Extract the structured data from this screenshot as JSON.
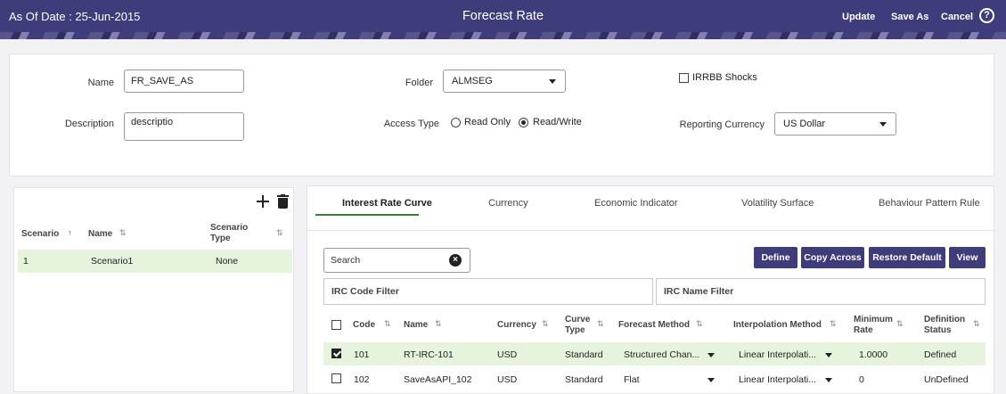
{
  "header": {
    "as_of_date": "As Of Date : 25-Jun-2015",
    "title": "Forecast Rate",
    "update_label": "Update",
    "save_as_label": "Save As",
    "cancel_label": "Cancel",
    "help_label": "?"
  },
  "form": {
    "name_label": "Name",
    "name_value": "FR_SAVE_AS",
    "description_label": "Description",
    "description_value": "descriptio",
    "folder_label": "Folder",
    "folder_value": "ALMSEG",
    "access_type_label": "Access Type",
    "access_options": [
      "Read Only",
      "Read/Write"
    ],
    "access_selected": "Read/Write",
    "irrbb_label": "IRRBB Shocks",
    "irrbb_checked": false,
    "reporting_currency_label": "Reporting Currency",
    "reporting_currency_value": "US Dollar"
  },
  "scenario_panel": {
    "columns": [
      "Scenario",
      "Name",
      "Scenario Type"
    ],
    "rows": [
      {
        "scenario": "1",
        "name": "Scenario1",
        "type": "None"
      }
    ]
  },
  "tabs": [
    "Interest Rate Curve",
    "Currency",
    "Economic Indicator",
    "Volatility Surface",
    "Behaviour Pattern Rule"
  ],
  "active_tab": "Interest Rate Curve",
  "toolbar": {
    "search_placeholder": "Search",
    "define_label": "Define",
    "copy_across_label": "Copy Across",
    "restore_default_label": "Restore Default",
    "view_label": "View"
  },
  "filters": {
    "irc_code": "IRC Code Filter",
    "irc_name": "IRC Name Filter"
  },
  "grid": {
    "columns": {
      "code": "Code",
      "name": "Name",
      "currency": "Currency",
      "curve_type": "Curve Type",
      "forecast_method": "Forecast Method",
      "interpolation_method": "Interpolation Method",
      "minimum_rate": "Minimum Rate",
      "definition_status": "Definition Status"
    },
    "rows": [
      {
        "checked": true,
        "code": "101",
        "name": "RT-IRC-101",
        "currency": "USD",
        "curve_type": "Standard",
        "forecast_method": "Structured Chan...",
        "interpolation_method": "Linear Interpolati...",
        "minimum_rate": "1.0000",
        "definition_status": "Defined"
      },
      {
        "checked": false,
        "code": "102",
        "name": "SaveAsAPI_102",
        "currency": "USD",
        "curve_type": "Standard",
        "forecast_method": "Flat",
        "interpolation_method": "Linear Interpolati...",
        "minimum_rate": "0",
        "definition_status": "UnDefined"
      }
    ]
  },
  "colors": {
    "header": "#3e3c7a",
    "selected_row": "#e6f4dd",
    "button": "#3e3c7a"
  }
}
